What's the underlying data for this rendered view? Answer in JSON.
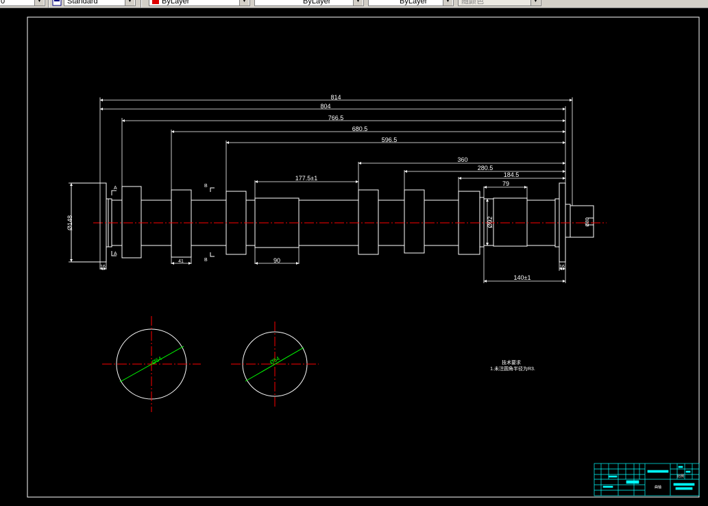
{
  "toolbar": {
    "combo1_value": "0",
    "combo2_value": "Standard",
    "combo3_value": "ByLayer",
    "combo4_value": "ByLayer",
    "combo5_value": "ByLayer",
    "combo6_value": "随颜色",
    "combo3_swatch_color": "#e00000"
  },
  "drawing": {
    "dimensions": {
      "d_814": "814",
      "d_804": "804",
      "d_766_5": "766.5",
      "d_680_5": "680.5",
      "d_596_5": "596.5",
      "d_360": "360",
      "d_280_5": "280.5",
      "d_184_5": "184.5",
      "d_79": "79",
      "d_177_5": "177.5±1",
      "d_phi148": "Ø148",
      "d_phi92": "Ø92",
      "d_phi80": "Ø80",
      "d_16_left": "16",
      "d_16_right": "16",
      "d_41": "41",
      "d_90": "90",
      "d_140": "140±1",
      "d_phi54_a": "Ø54",
      "d_phi54_b": "Ø54"
    },
    "section_marks": {
      "a_top": "A",
      "a_bottom": "A",
      "b_top": "B",
      "b_bottom": "B"
    },
    "notes": {
      "title": "技术要求",
      "line1": "1.未注圆角半径为R3."
    },
    "title_block": {
      "center_label": "曲轴",
      "scale_label": "比例"
    },
    "colors": {
      "line": "#ffffff",
      "centerline": "#ff0000",
      "dimension_green": "#00ff00",
      "title_block": "#00ffff"
    }
  }
}
